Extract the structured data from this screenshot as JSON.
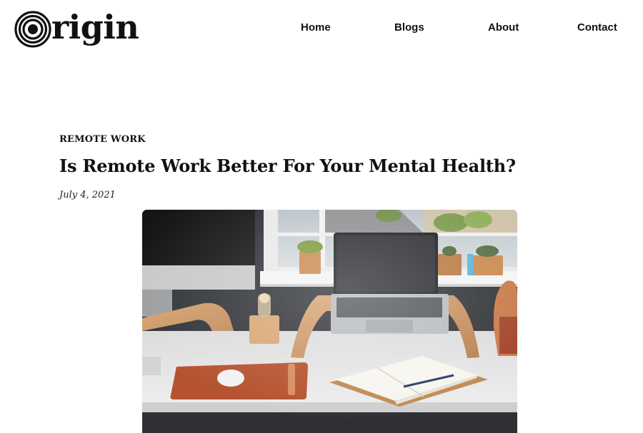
{
  "logo": {
    "text": "rigin",
    "icon": "concentric-circles-o-logo"
  },
  "nav": {
    "items": [
      {
        "label": "Home"
      },
      {
        "label": "Blogs"
      },
      {
        "label": "About"
      },
      {
        "label": "Contact"
      }
    ]
  },
  "post": {
    "category": "REMOTE WORK",
    "title": "Is Remote Work Better For Your Mental Health?",
    "date": "July 4, 2021",
    "image": {
      "subject": "desk-with-laptop-monitor-plants-notebook-photo"
    }
  },
  "colors": {
    "text": "#111111",
    "background": "#ffffff"
  }
}
